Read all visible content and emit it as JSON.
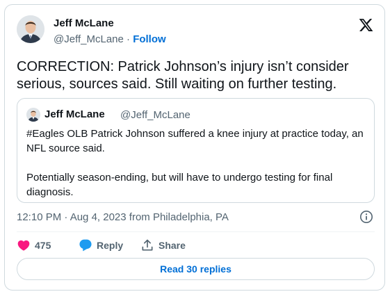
{
  "author": {
    "name": "Jeff McLane",
    "handle": "@Jeff_McLane",
    "separator": "·",
    "follow_label": "Follow"
  },
  "tweet": {
    "text": "CORRECTION: Patrick Johnson’s injury isn’t consider serious, sources said. Still waiting on further testing."
  },
  "quoted": {
    "name": "Jeff McLane",
    "handle": "@Jeff_McLane",
    "paragraph1": "#Eagles OLB Patrick Johnson suffered a knee injury at practice today, an NFL source said.",
    "paragraph2": "Potentially season-ending, but will have to undergo testing for final diagnosis."
  },
  "meta": {
    "timestamp": "12:10 PM · Aug 4, 2023 from Philadelphia, PA"
  },
  "actions": {
    "likes_count": "475",
    "reply_label": "Reply",
    "share_label": "Share"
  },
  "read_replies_label": "Read 30 replies",
  "colors": {
    "link": "#006fd6",
    "like": "#f91880",
    "reply": "#1d9bf0",
    "text": "#0f1419",
    "muted": "#536471",
    "border": "#cfd9de"
  },
  "icons": [
    "x-logo-icon",
    "heart-icon",
    "reply-bubble-icon",
    "share-icon",
    "info-icon"
  ]
}
